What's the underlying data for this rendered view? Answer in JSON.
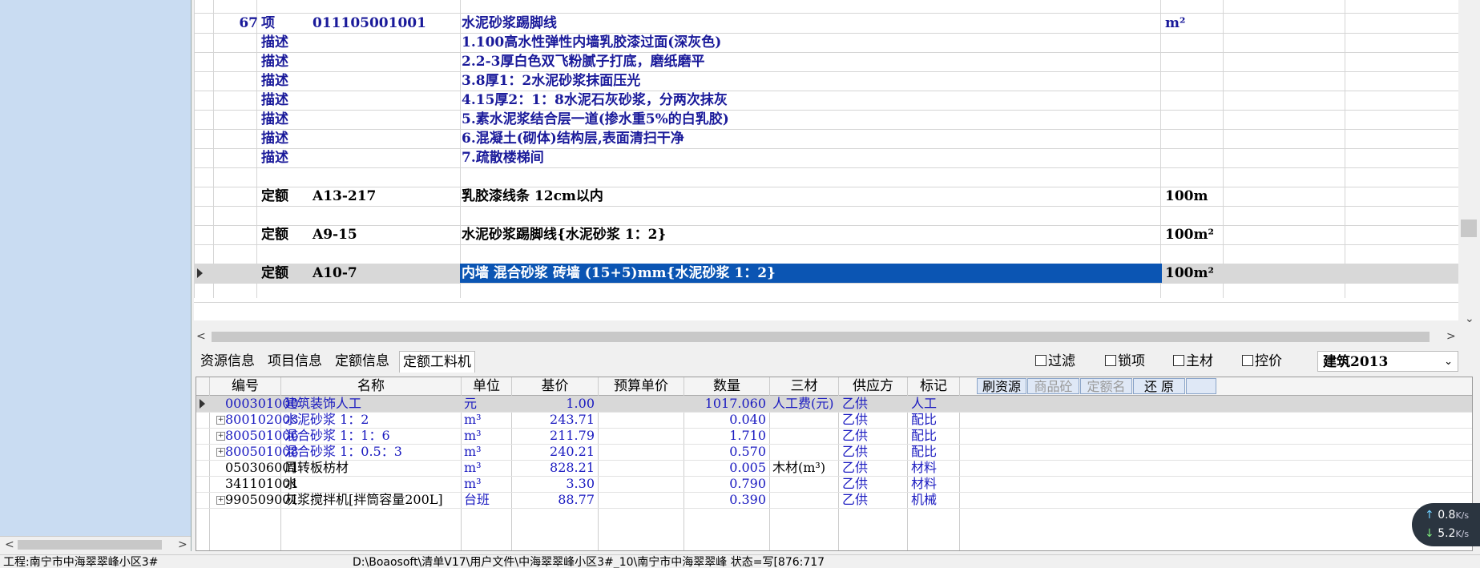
{
  "top_rows": [
    {
      "num": "67",
      "type": "项",
      "code": "011105001001",
      "name": "水泥砂浆踢脚线",
      "unit": "m²",
      "selected": false
    },
    {
      "num": "",
      "type": "描述",
      "code": "",
      "name": "1.100高水性弹性内墙乳胶漆过面(深灰色)",
      "unit": "",
      "selected": false
    },
    {
      "num": "",
      "type": "描述",
      "code": "",
      "name": "2.2-3厚白色双飞粉腻子打底，磨纸磨平",
      "unit": "",
      "selected": false
    },
    {
      "num": "",
      "type": "描述",
      "code": "",
      "name": "3.8厚1：2水泥砂浆抹面压光",
      "unit": "",
      "selected": false
    },
    {
      "num": "",
      "type": "描述",
      "code": "",
      "name": "4.15厚2：1：8水泥石灰砂浆，分两次抹灰",
      "unit": "",
      "selected": false
    },
    {
      "num": "",
      "type": "描述",
      "code": "",
      "name": "5.素水泥浆结合层一道(掺水重5%的白乳胶)",
      "unit": "",
      "selected": false
    },
    {
      "num": "",
      "type": "描述",
      "code": "",
      "name": "6.混凝土(砌体)结构层,表面清扫干净",
      "unit": "",
      "selected": false
    },
    {
      "num": "",
      "type": "描述",
      "code": "",
      "name": "7.疏散楼梯间",
      "unit": "",
      "selected": false
    },
    {
      "num": "",
      "type": "",
      "code": "",
      "name": "",
      "unit": "",
      "selected": false
    },
    {
      "num": "",
      "type": "定额",
      "code": "A13-217",
      "name": "乳胶漆线条 12cm以内",
      "unit": "100m",
      "selected": false
    },
    {
      "num": "",
      "type": "",
      "code": "",
      "name": "",
      "unit": "",
      "selected": false
    },
    {
      "num": "",
      "type": "定额",
      "code": "A9-15",
      "name": "水泥砂浆踢脚线{水泥砂浆 1：2}",
      "unit": "100m²",
      "selected": false
    },
    {
      "num": "",
      "type": "",
      "code": "",
      "name": "",
      "unit": "",
      "selected": false
    },
    {
      "num": "",
      "type": "定额",
      "code": "A10-7",
      "name": "内墙 混合砂浆 砖墙 (15+5)mm{水泥砂浆 1：2}",
      "unit": "100m²",
      "selected": true
    },
    {
      "num": "",
      "type": "",
      "code": "",
      "name": "",
      "unit": "",
      "selected": false
    }
  ],
  "tabs": {
    "resource_info": "资源信息",
    "project_info": "项目信息",
    "quota_info": "定额信息",
    "quota_labor": "定额工料机"
  },
  "filters": {
    "filter": "过滤",
    "lock_item": "锁项",
    "main_material": "主材",
    "price_control": "控价"
  },
  "standard_select": "建筑2013",
  "bottom_headers": {
    "code": "编号",
    "name": "名称",
    "unit": "单位",
    "base_price": "基价",
    "budget_price": "预算单价",
    "quantity": "数量",
    "three_materials": "三材",
    "supplier": "供应方",
    "mark": "标记"
  },
  "bottom_buttons": {
    "refresh": "刷资源",
    "concrete": "商品砼",
    "quota_name": "定额名",
    "restore": "还 原"
  },
  "bottom_rows": [
    {
      "code": "000301000",
      "name": "建筑装饰人工",
      "unit": "元",
      "base": "1.00",
      "budget": "",
      "qty": "1017.060",
      "mat": "人工费(元)",
      "sup": "乙供",
      "mark": "人工",
      "expand": false,
      "selected": true,
      "blue": true
    },
    {
      "code": "800102003",
      "name": "水泥砂浆 1：2",
      "unit": "m³",
      "base": "243.71",
      "budget": "",
      "qty": "0.040",
      "mat": "",
      "sup": "乙供",
      "mark": "配比",
      "expand": true,
      "selected": false,
      "blue": true
    },
    {
      "code": "800501006",
      "name": "混合砂浆 1：1：6",
      "unit": "m³",
      "base": "211.79",
      "budget": "",
      "qty": "1.710",
      "mat": "",
      "sup": "乙供",
      "mark": "配比",
      "expand": true,
      "selected": false,
      "blue": true
    },
    {
      "code": "800501008",
      "name": "混合砂浆 1：0.5：3",
      "unit": "m³",
      "base": "240.21",
      "budget": "",
      "qty": "0.570",
      "mat": "",
      "sup": "乙供",
      "mark": "配比",
      "expand": true,
      "selected": false,
      "blue": true
    },
    {
      "code": "050306001",
      "name": "周转板枋材",
      "unit": "m³",
      "base": "828.21",
      "budget": "",
      "qty": "0.005",
      "mat": "木材(m³)",
      "sup": "乙供",
      "mark": "材料",
      "expand": false,
      "selected": false,
      "blue": false
    },
    {
      "code": "341101001",
      "name": "水",
      "unit": "m³",
      "base": "3.30",
      "budget": "",
      "qty": "0.790",
      "mat": "",
      "sup": "乙供",
      "mark": "材料",
      "expand": false,
      "selected": false,
      "blue": false
    },
    {
      "code": "990509001",
      "name": "灰浆搅拌机[拌筒容量200L]",
      "unit": "台班",
      "base": "88.77",
      "budget": "",
      "qty": "0.390",
      "mat": "",
      "sup": "乙供",
      "mark": "机械",
      "expand": true,
      "selected": false,
      "blue": false
    }
  ],
  "status": {
    "project": "工程:南宁市中海翠翠峰小区3#",
    "path": "D:\\Boaosoft\\清单V17\\用户文件\\中海翠翠峰小区3#_10\\南宁市中海翠翠峰 状态=写[876:717"
  },
  "speed": {
    "up": "0.8",
    "down": "5.2",
    "unit": "K/s"
  },
  "colors": {
    "selection": "#0b55b3",
    "blue_text": "#1a1ac0",
    "left_panel": "#c9dcf2"
  }
}
